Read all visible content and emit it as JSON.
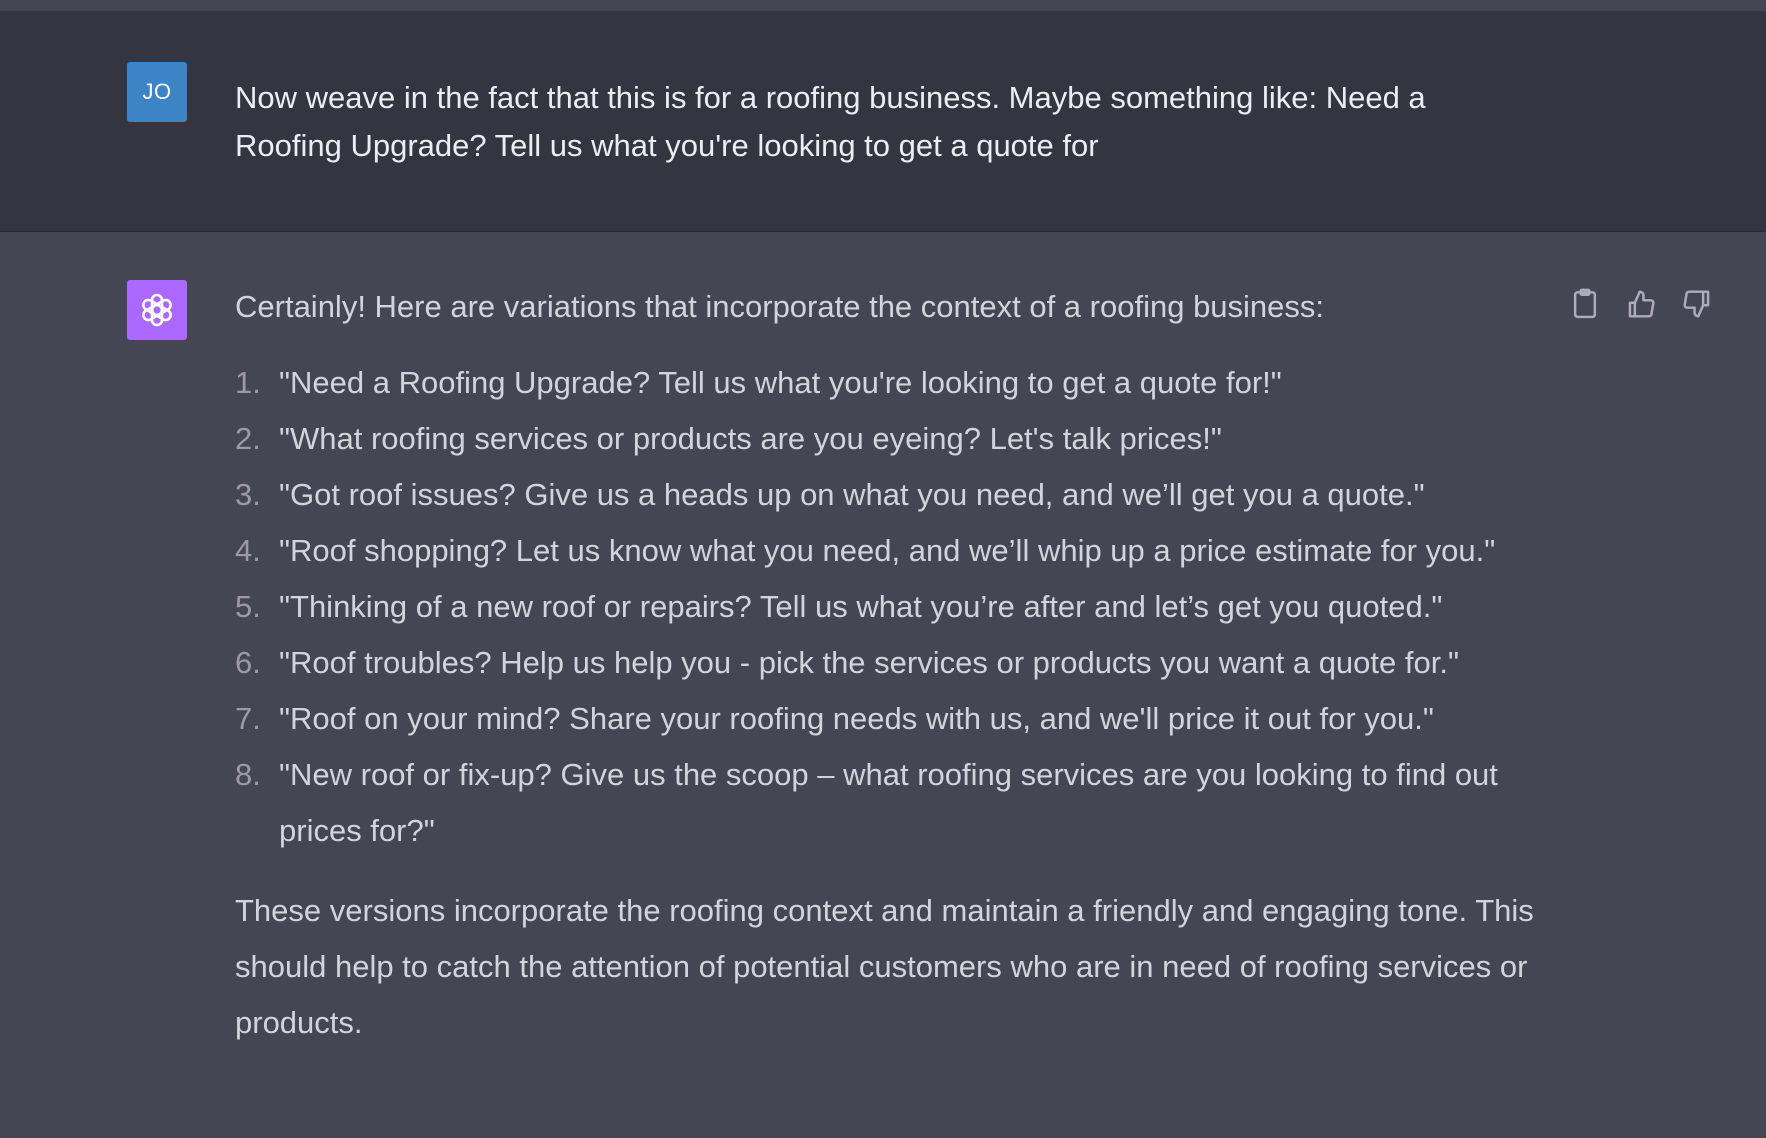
{
  "conversation": {
    "user_message": {
      "avatar_initials": "JO",
      "avatar_color": "#3d84c6",
      "text": "Now weave in the fact that this is for a roofing business. Maybe something like: Need a Roofing Upgrade? Tell us what you're looking to get a quote for"
    },
    "assistant_message": {
      "avatar_icon": "openai-logo-icon",
      "avatar_color": "#ab68ff",
      "intro": "Certainly! Here are variations that incorporate the context of a roofing business:",
      "items": [
        {
          "num": "1.",
          "text": "\"Need a Roofing Upgrade? Tell us what you're looking to get a quote for!\""
        },
        {
          "num": "2.",
          "text": "\"What roofing services or products are you eyeing? Let's talk prices!\""
        },
        {
          "num": "3.",
          "text": "\"Got roof issues? Give us a heads up on what you need, and we’ll get you a quote.\""
        },
        {
          "num": "4.",
          "text": "\"Roof shopping? Let us know what you need, and we’ll whip up a price estimate for you.\""
        },
        {
          "num": "5.",
          "text": "\"Thinking of a new roof or repairs? Tell us what you’re after and let’s get you quoted.\""
        },
        {
          "num": "6.",
          "text": "\"Roof troubles? Help us help you - pick the services or products you want a quote for.\""
        },
        {
          "num": "7.",
          "text": "\"Roof on your mind? Share your roofing needs with us, and we'll price it out for you.\""
        },
        {
          "num": "8.",
          "text": "\"New roof or fix-up? Give us the scoop – what roofing services are you looking to find out prices for?\""
        }
      ],
      "closing": "These versions incorporate the roofing context and maintain a friendly and engaging tone. This should help to catch the attention of potential customers who are in need of roofing services or products.",
      "actions": [
        {
          "icon": "clipboard-icon"
        },
        {
          "icon": "thumbs-up-icon"
        },
        {
          "icon": "thumbs-down-icon"
        }
      ]
    }
  },
  "colors": {
    "user_bg": "#343541",
    "assistant_bg": "#444654",
    "text": "#ececf1"
  }
}
